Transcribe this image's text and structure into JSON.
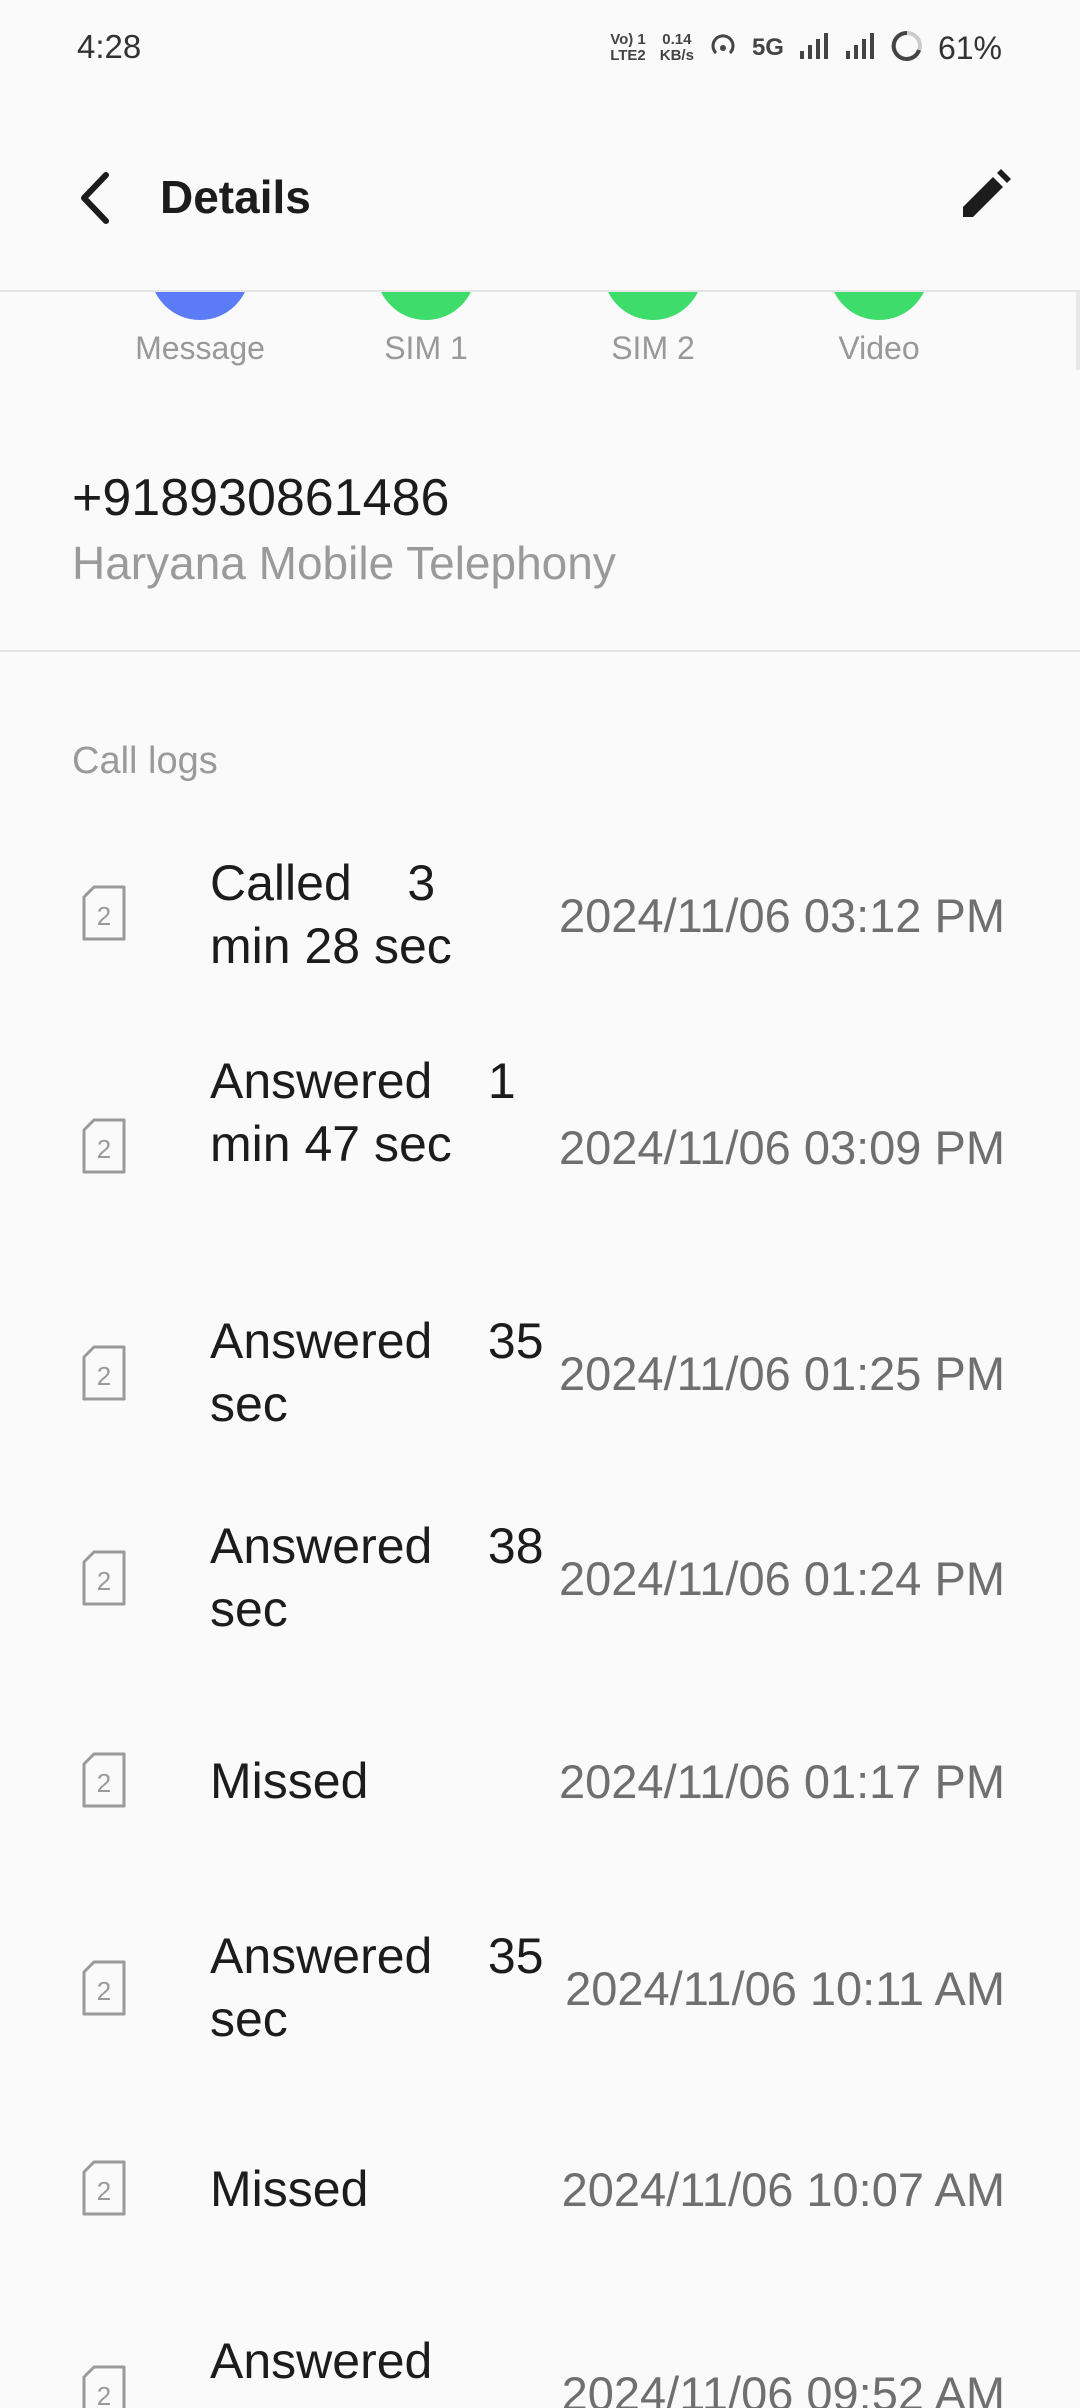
{
  "status_bar": {
    "time": "4:28",
    "volte": "Vo) 1",
    "lte": "LTE2",
    "speed_value": "0.14",
    "speed_unit": "KB/s",
    "network": "5G",
    "battery": "61%"
  },
  "header": {
    "title": "Details",
    "back_icon": "chevron-left-icon",
    "edit_icon": "pencil-icon"
  },
  "actions": [
    {
      "label": "Message",
      "color": "#5b7cf6"
    },
    {
      "label": "SIM 1",
      "color": "#3ddc6b"
    },
    {
      "label": "SIM 2",
      "color": "#3ddc6b"
    },
    {
      "label": "Video",
      "color": "#3ddc6b"
    }
  ],
  "contact": {
    "number": "+918930861486",
    "carrier": "Haryana Mobile Telephony"
  },
  "call_logs": {
    "heading": "Call logs",
    "sim_label": "2",
    "entries": [
      {
        "type": "Called",
        "duration": "3 min 28 sec",
        "datetime": "2024/11/06 03:12 PM"
      },
      {
        "type": "Answered",
        "duration": "1 min 47 sec",
        "datetime": "2024/11/06 03:09 PM"
      },
      {
        "type": "Answered",
        "duration": "35 sec",
        "datetime": "2024/11/06 01:25 PM"
      },
      {
        "type": "Answered",
        "duration": "38 sec",
        "datetime": "2024/11/06 01:24 PM"
      },
      {
        "type": "Missed",
        "duration": "",
        "datetime": "2024/11/06 01:17 PM"
      },
      {
        "type": "Answered",
        "duration": "35 sec",
        "datetime": "2024/11/06 10:11 AM"
      },
      {
        "type": "Missed",
        "duration": "",
        "datetime": "2024/11/06 10:07 AM"
      },
      {
        "type": "Answered",
        "duration": "",
        "datetime": "2024/11/06 09:52 AM"
      }
    ]
  },
  "colors": {
    "background": "#fafafa",
    "primary_text": "#1c1c1c",
    "secondary_text": "#9a9a9a",
    "datetime_text": "#6f6f6f"
  }
}
